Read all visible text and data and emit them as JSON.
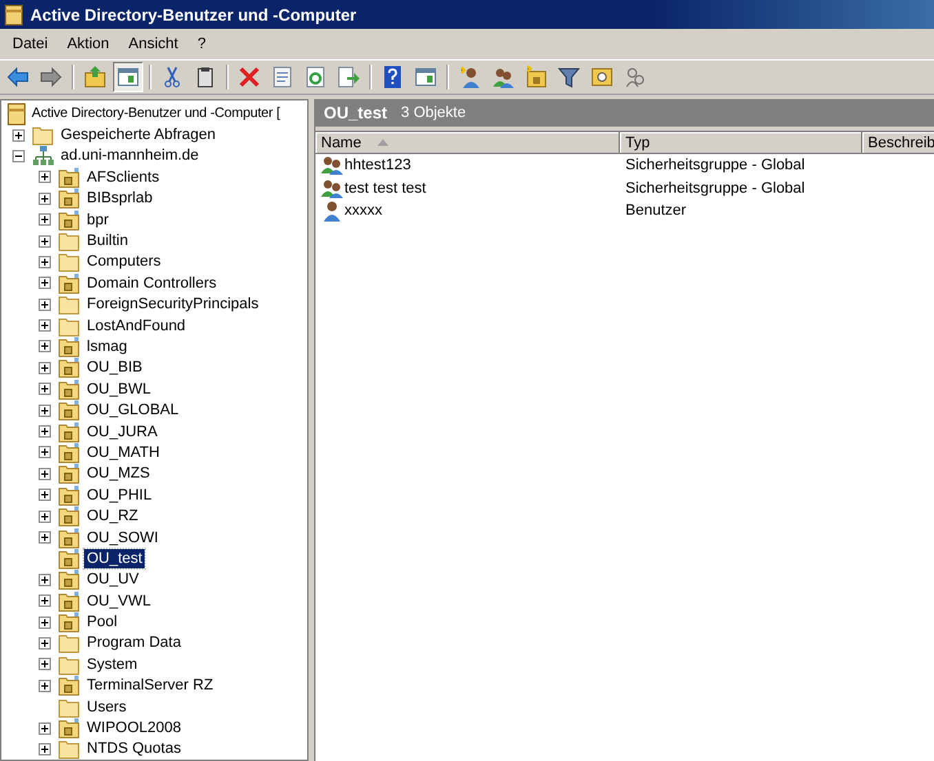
{
  "window": {
    "title": "Active Directory-Benutzer und -Computer"
  },
  "menu": [
    "Datei",
    "Aktion",
    "Ansicht",
    "?"
  ],
  "toolbar": [
    [
      {
        "kind": "back",
        "pressed": false
      },
      {
        "kind": "forward",
        "pressed": false
      }
    ],
    [
      {
        "kind": "up",
        "pressed": false
      },
      {
        "kind": "tree",
        "pressed": true
      }
    ],
    [
      {
        "kind": "cut",
        "pressed": false
      },
      {
        "kind": "paste",
        "pressed": false
      }
    ],
    [
      {
        "kind": "delete",
        "pressed": false
      },
      {
        "kind": "properties",
        "pressed": false
      },
      {
        "kind": "refresh",
        "pressed": false
      },
      {
        "kind": "export",
        "pressed": false
      }
    ],
    [
      {
        "kind": "help",
        "pressed": false
      },
      {
        "kind": "console",
        "pressed": false
      }
    ],
    [
      {
        "kind": "newuser",
        "pressed": false
      },
      {
        "kind": "newgroup",
        "pressed": false
      },
      {
        "kind": "newou",
        "pressed": false
      },
      {
        "kind": "filter",
        "pressed": false
      },
      {
        "kind": "find",
        "pressed": false
      },
      {
        "kind": "delegate",
        "pressed": false
      }
    ]
  ],
  "tree": {
    "label": "Active Directory-Benutzer und -Computer [",
    "kind": "root",
    "expandable": false,
    "selected": false,
    "children": [
      {
        "label": "Gespeicherte Abfragen",
        "kind": "folder",
        "expandable": true,
        "expanded": false,
        "selected": false
      },
      {
        "label": "ad.uni-mannheim.de",
        "kind": "domain",
        "expandable": true,
        "expanded": true,
        "selected": false,
        "children": [
          {
            "label": "AFSclients",
            "kind": "ou",
            "expandable": true,
            "expanded": false,
            "selected": false
          },
          {
            "label": "BIBsprlab",
            "kind": "ou",
            "expandable": true,
            "expanded": false,
            "selected": false
          },
          {
            "label": "bpr",
            "kind": "ou",
            "expandable": true,
            "expanded": false,
            "selected": false
          },
          {
            "label": "Builtin",
            "kind": "folder",
            "expandable": true,
            "expanded": false,
            "selected": false
          },
          {
            "label": "Computers",
            "kind": "folder",
            "expandable": true,
            "expanded": false,
            "selected": false
          },
          {
            "label": "Domain Controllers",
            "kind": "ou",
            "expandable": true,
            "expanded": false,
            "selected": false
          },
          {
            "label": "ForeignSecurityPrincipals",
            "kind": "folder",
            "expandable": true,
            "expanded": false,
            "selected": false
          },
          {
            "label": "LostAndFound",
            "kind": "folder",
            "expandable": true,
            "expanded": false,
            "selected": false
          },
          {
            "label": "lsmag",
            "kind": "ou",
            "expandable": true,
            "expanded": false,
            "selected": false
          },
          {
            "label": "OU_BIB",
            "kind": "ou",
            "expandable": true,
            "expanded": false,
            "selected": false
          },
          {
            "label": "OU_BWL",
            "kind": "ou",
            "expandable": true,
            "expanded": false,
            "selected": false
          },
          {
            "label": "OU_GLOBAL",
            "kind": "ou",
            "expandable": true,
            "expanded": false,
            "selected": false
          },
          {
            "label": "OU_JURA",
            "kind": "ou",
            "expandable": true,
            "expanded": false,
            "selected": false
          },
          {
            "label": "OU_MATH",
            "kind": "ou",
            "expandable": true,
            "expanded": false,
            "selected": false
          },
          {
            "label": "OU_MZS",
            "kind": "ou",
            "expandable": true,
            "expanded": false,
            "selected": false
          },
          {
            "label": "OU_PHIL",
            "kind": "ou",
            "expandable": true,
            "expanded": false,
            "selected": false
          },
          {
            "label": "OU_RZ",
            "kind": "ou",
            "expandable": true,
            "expanded": false,
            "selected": false
          },
          {
            "label": "OU_SOWI",
            "kind": "ou",
            "expandable": true,
            "expanded": false,
            "selected": false
          },
          {
            "label": "OU_test",
            "kind": "ou",
            "expandable": false,
            "selected": true
          },
          {
            "label": "OU_UV",
            "kind": "ou",
            "expandable": true,
            "expanded": false,
            "selected": false
          },
          {
            "label": "OU_VWL",
            "kind": "ou",
            "expandable": true,
            "expanded": false,
            "selected": false
          },
          {
            "label": "Pool",
            "kind": "ou",
            "expandable": true,
            "expanded": false,
            "selected": false
          },
          {
            "label": "Program Data",
            "kind": "folder",
            "expandable": true,
            "expanded": false,
            "selected": false
          },
          {
            "label": "System",
            "kind": "folder",
            "expandable": true,
            "expanded": false,
            "selected": false
          },
          {
            "label": "TerminalServer RZ",
            "kind": "ou",
            "expandable": true,
            "expanded": false,
            "selected": false
          },
          {
            "label": "Users",
            "kind": "folder",
            "expandable": false,
            "selected": false
          },
          {
            "label": "WIPOOL2008",
            "kind": "ou",
            "expandable": true,
            "expanded": false,
            "selected": false
          },
          {
            "label": "NTDS Quotas",
            "kind": "folder",
            "expandable": true,
            "expanded": false,
            "selected": false
          }
        ]
      }
    ]
  },
  "content": {
    "title": "OU_test",
    "count": "3 Objekte",
    "columns": [
      {
        "label": "Name",
        "sorted": true
      },
      {
        "label": "Typ",
        "sorted": false
      },
      {
        "label": "Beschreib",
        "sorted": false
      }
    ],
    "rows": [
      {
        "kind": "group",
        "name": "hhtest123",
        "type": "Sicherheitsgruppe - Global"
      },
      {
        "kind": "group",
        "name": "test test test",
        "type": "Sicherheitsgruppe - Global"
      },
      {
        "kind": "user",
        "name": "xxxxx",
        "type": "Benutzer"
      }
    ]
  }
}
